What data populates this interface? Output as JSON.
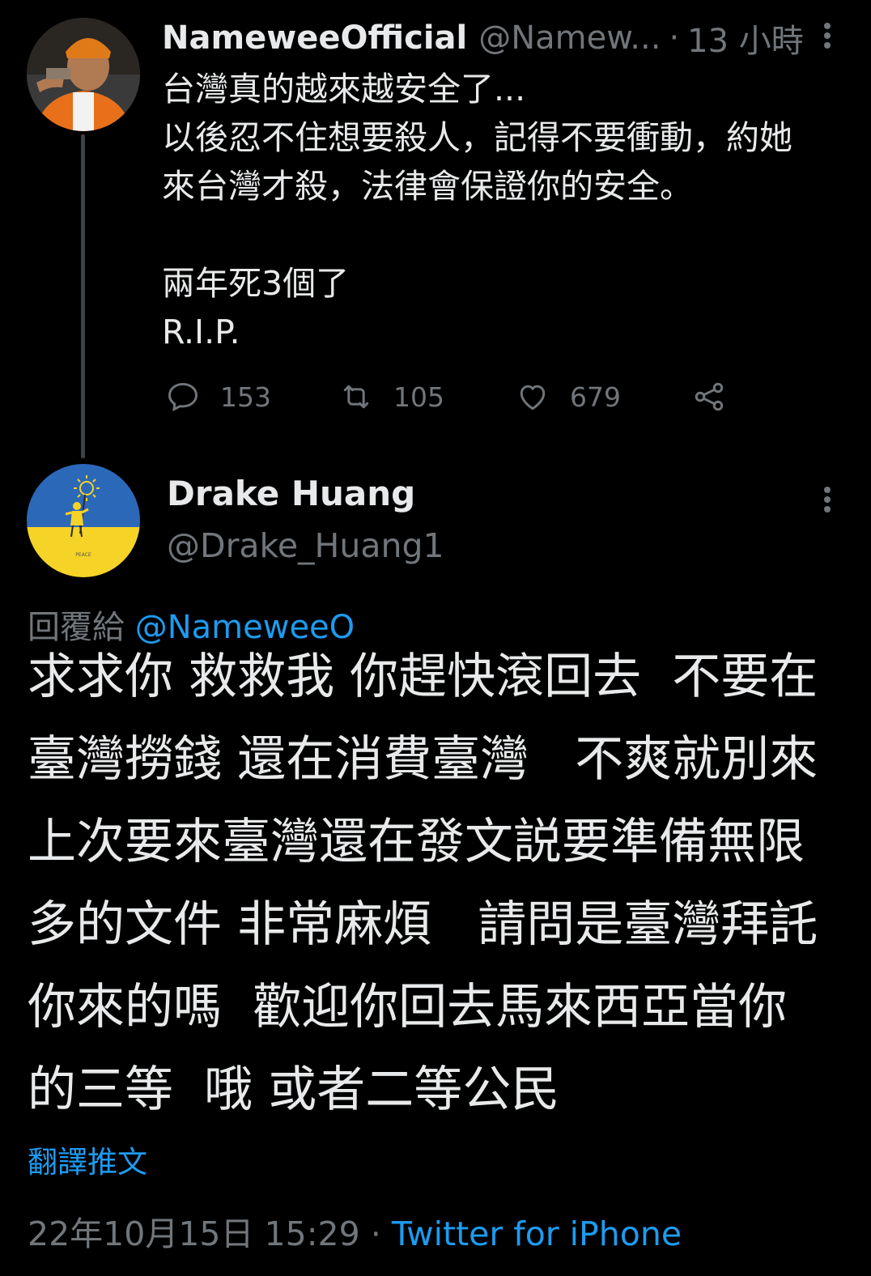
{
  "colors": {
    "background": "#000000",
    "text_primary": "#e7e9ea",
    "text_secondary": "#71767b",
    "accent": "#1d9bf0"
  },
  "tweet1": {
    "author_name": "NameweeOfficial",
    "author_handle": "@Namew...",
    "separator": "·",
    "time": "13 小時",
    "body_lines": [
      "台灣真的越來越安全了...",
      "以後忍不住想要殺人，記得不要衝動，約她",
      "來台灣才殺，法律會保證你的安全。",
      "",
      "兩年死3個了",
      "R.I.P."
    ],
    "actions": {
      "reply_count": "153",
      "retweet_count": "105",
      "like_count": "679"
    },
    "icons": {
      "more": "more-vertical-icon",
      "reply": "comment-bubble-icon",
      "retweet": "retweet-icon",
      "like": "heart-icon",
      "share": "share-icon"
    }
  },
  "tweet2": {
    "author_name": "Drake Huang",
    "author_handle": "@Drake_Huang1",
    "reply_prefix": "回覆給",
    "reply_mention": "@NameweeO",
    "body_lines": [
      "求求你 救救我 你趕快滾回去  不要在",
      "臺灣撈錢 還在消費臺灣   不爽就別來",
      "上次要來臺灣還在發文説要準備無限",
      "多的文件 非常麻煩   請問是臺灣拜託",
      "你來的嗎  歡迎你回去馬來西亞當你",
      "的三等  哦 或者二等公民"
    ],
    "avatar_caption": "PEACE",
    "translate_label": "翻譯推文",
    "timestamp": "22年10月15日 15:29",
    "meta_separator": " · ",
    "source": "Twitter for iPhone"
  }
}
